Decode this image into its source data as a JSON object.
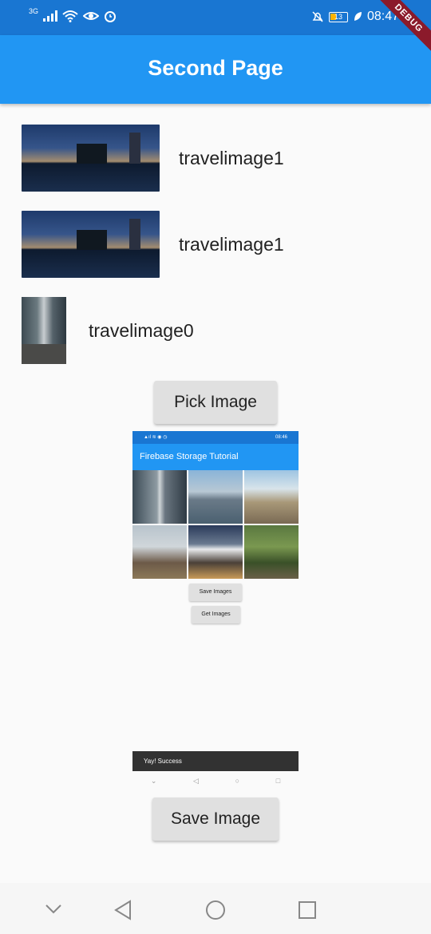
{
  "status_bar": {
    "network": "3G",
    "battery": "13",
    "time": "08:47"
  },
  "debug_banner": "DEBUG",
  "app_bar": {
    "title": "Second Page"
  },
  "list": [
    {
      "label": "travelimage1"
    },
    {
      "label": "travelimage1"
    },
    {
      "label": "travelimage0"
    }
  ],
  "buttons": {
    "pick_image": "Pick Image",
    "save_image": "Save Image"
  },
  "preview": {
    "status_time": "08:46",
    "title": "Firebase Storage Tutorial",
    "save_images": "Save Images",
    "get_images": "Get Images",
    "snackbar": "Yay! Success"
  },
  "colors": {
    "app_bar": "#2196f3",
    "status_bar": "#1976d2",
    "button": "#e0e0e0",
    "debug_ribbon": "#8b1a2b"
  },
  "icons": {
    "nav": [
      "chevron-down-icon",
      "back-icon",
      "home-icon",
      "recents-icon"
    ]
  }
}
